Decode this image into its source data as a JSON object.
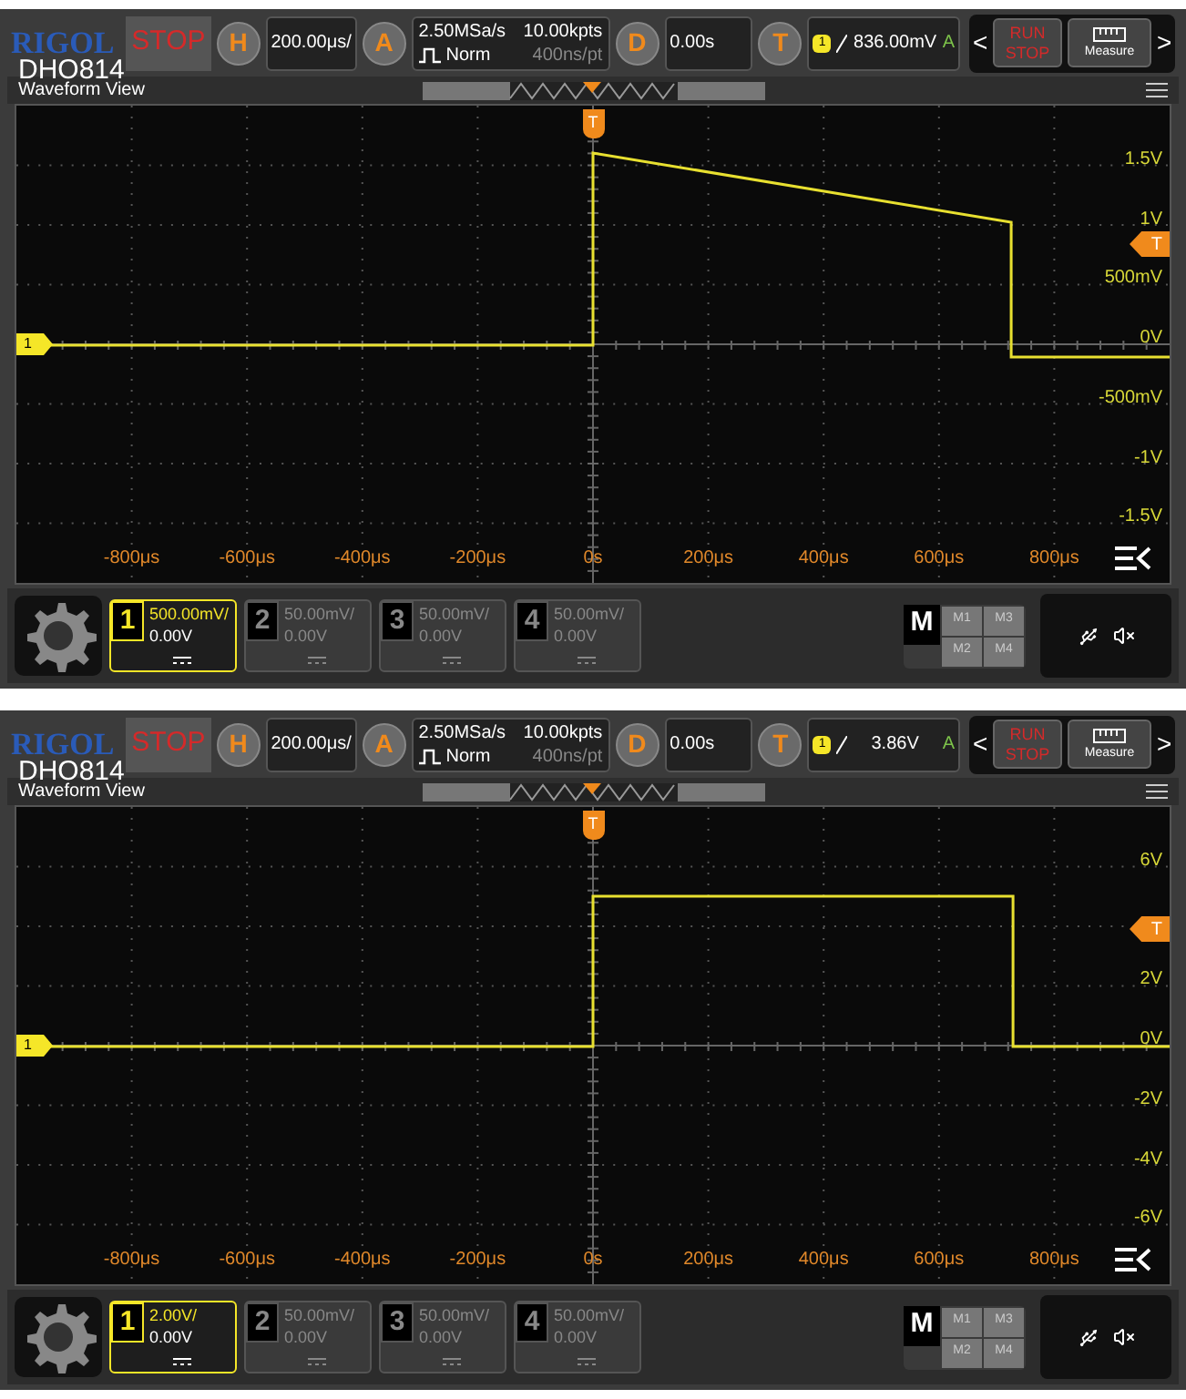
{
  "screens": [
    {
      "brand": "RIGOL",
      "run_state": "STOP",
      "model": "DHO814",
      "horizontal": {
        "key": "H",
        "value": "200.00μs/"
      },
      "acquire": {
        "key": "A",
        "rate": "2.50MSa/s",
        "mode": "Norm",
        "points": "10.00kpts",
        "per_point": "400ns/pt"
      },
      "delay": {
        "key": "D",
        "value": "0.00s"
      },
      "trigger": {
        "key": "T",
        "source": "1",
        "level": "836.00mV",
        "status": "A"
      },
      "nav_prev": "<",
      "nav_next": ">",
      "run_stop": {
        "run": "RUN",
        "stop": "STOP"
      },
      "measure": "Measure",
      "view_title": "Waveform View",
      "trigger_time_marker": "T",
      "trigger_level_marker": "T",
      "trace": {
        "kind": "decay"
      },
      "channel_marker": "1",
      "y_labels": [
        {
          "kind": "label",
          "text": "1.5V"
        },
        {
          "kind": "label",
          "text": "1V"
        },
        {
          "kind": "label",
          "text": "500mV"
        },
        {
          "kind": "label",
          "text": "0V"
        },
        {
          "kind": "label",
          "text": "-500mV"
        },
        {
          "kind": "label",
          "text": "-1V"
        },
        {
          "kind": "label",
          "text": "-1.5V"
        }
      ],
      "x_labels": [
        "-800μs",
        "-600μs",
        "-400μs",
        "-200μs",
        "0s",
        "200μs",
        "400μs",
        "600μs",
        "800μs"
      ],
      "channels": [
        {
          "number": "1",
          "scale": "500.00mV/",
          "offset": "0.00V",
          "selected": true
        },
        {
          "number": "2",
          "scale": "50.00mV/",
          "offset": "0.00V",
          "selected": false
        },
        {
          "number": "3",
          "scale": "50.00mV/",
          "offset": "0.00V",
          "selected": false
        },
        {
          "number": "4",
          "scale": "50.00mV/",
          "offset": "0.00V",
          "selected": false
        }
      ],
      "math": {
        "key": "M",
        "items": [
          "M1",
          "M3",
          "M2",
          "M4"
        ]
      }
    },
    {
      "brand": "RIGOL",
      "run_state": "STOP",
      "model": "DHO814",
      "horizontal": {
        "key": "H",
        "value": "200.00μs/"
      },
      "acquire": {
        "key": "A",
        "rate": "2.50MSa/s",
        "mode": "Norm",
        "points": "10.00kpts",
        "per_point": "400ns/pt"
      },
      "delay": {
        "key": "D",
        "value": "0.00s"
      },
      "trigger": {
        "key": "T",
        "source": "1",
        "level": "3.86V",
        "status": "A"
      },
      "nav_prev": "<",
      "nav_next": ">",
      "run_stop": {
        "run": "RUN",
        "stop": "STOP"
      },
      "measure": "Measure",
      "view_title": "Waveform View",
      "trigger_time_marker": "T",
      "trigger_level_marker": "T",
      "trace": {
        "kind": "pulse"
      },
      "channel_marker": "1",
      "y_labels": [
        {
          "kind": "label",
          "text": "6V"
        },
        {
          "kind": "gap"
        },
        {
          "kind": "label",
          "text": "2V"
        },
        {
          "kind": "label",
          "text": "0V"
        },
        {
          "kind": "label",
          "text": "-2V"
        },
        {
          "kind": "label",
          "text": "-4V"
        },
        {
          "kind": "label",
          "text": "-6V"
        }
      ],
      "x_labels": [
        "-800μs",
        "-600μs",
        "-400μs",
        "-200μs",
        "0s",
        "200μs",
        "400μs",
        "600μs",
        "800μs"
      ],
      "channels": [
        {
          "number": "1",
          "scale": "2.00V/",
          "offset": "0.00V",
          "selected": true
        },
        {
          "number": "2",
          "scale": "50.00mV/",
          "offset": "0.00V",
          "selected": false
        },
        {
          "number": "3",
          "scale": "50.00mV/",
          "offset": "0.00V",
          "selected": false
        },
        {
          "number": "4",
          "scale": "50.00mV/",
          "offset": "0.00V",
          "selected": false
        }
      ],
      "math": {
        "key": "M",
        "items": [
          "M1",
          "M3",
          "M2",
          "M4"
        ]
      }
    }
  ]
}
